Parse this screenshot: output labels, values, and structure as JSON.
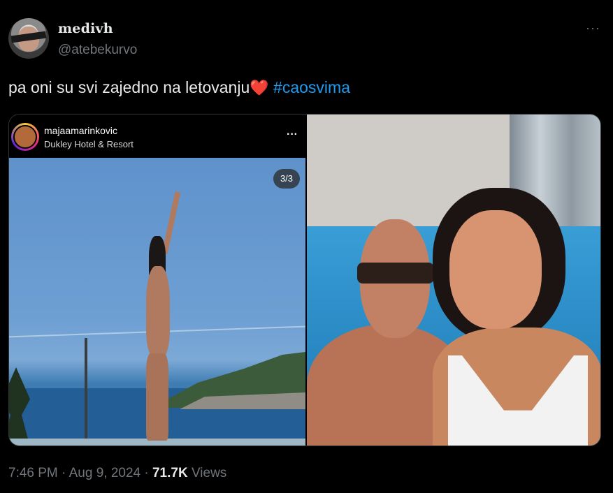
{
  "author": {
    "display_name": "medivh",
    "handle": "@atebekurvo"
  },
  "more_icon": "more-horizontal-icon",
  "tweet": {
    "text": "pa oni su svi zajedno na letovanju",
    "emoji": "❤️",
    "hashtag": "#caosvima"
  },
  "media": {
    "instagram": {
      "username": "majaamarinkovic",
      "location": "Dukley Hotel & Resort",
      "counter": "3/3"
    }
  },
  "meta": {
    "time": "7:46 PM",
    "separator": "·",
    "date": "Aug 9, 2024",
    "views_count": "71.7K",
    "views_label": "Views"
  },
  "colors": {
    "background": "#000000",
    "text": "#e7e9ea",
    "secondary": "#71767b",
    "link": "#1d9bf0",
    "heart": "#e0245e"
  }
}
